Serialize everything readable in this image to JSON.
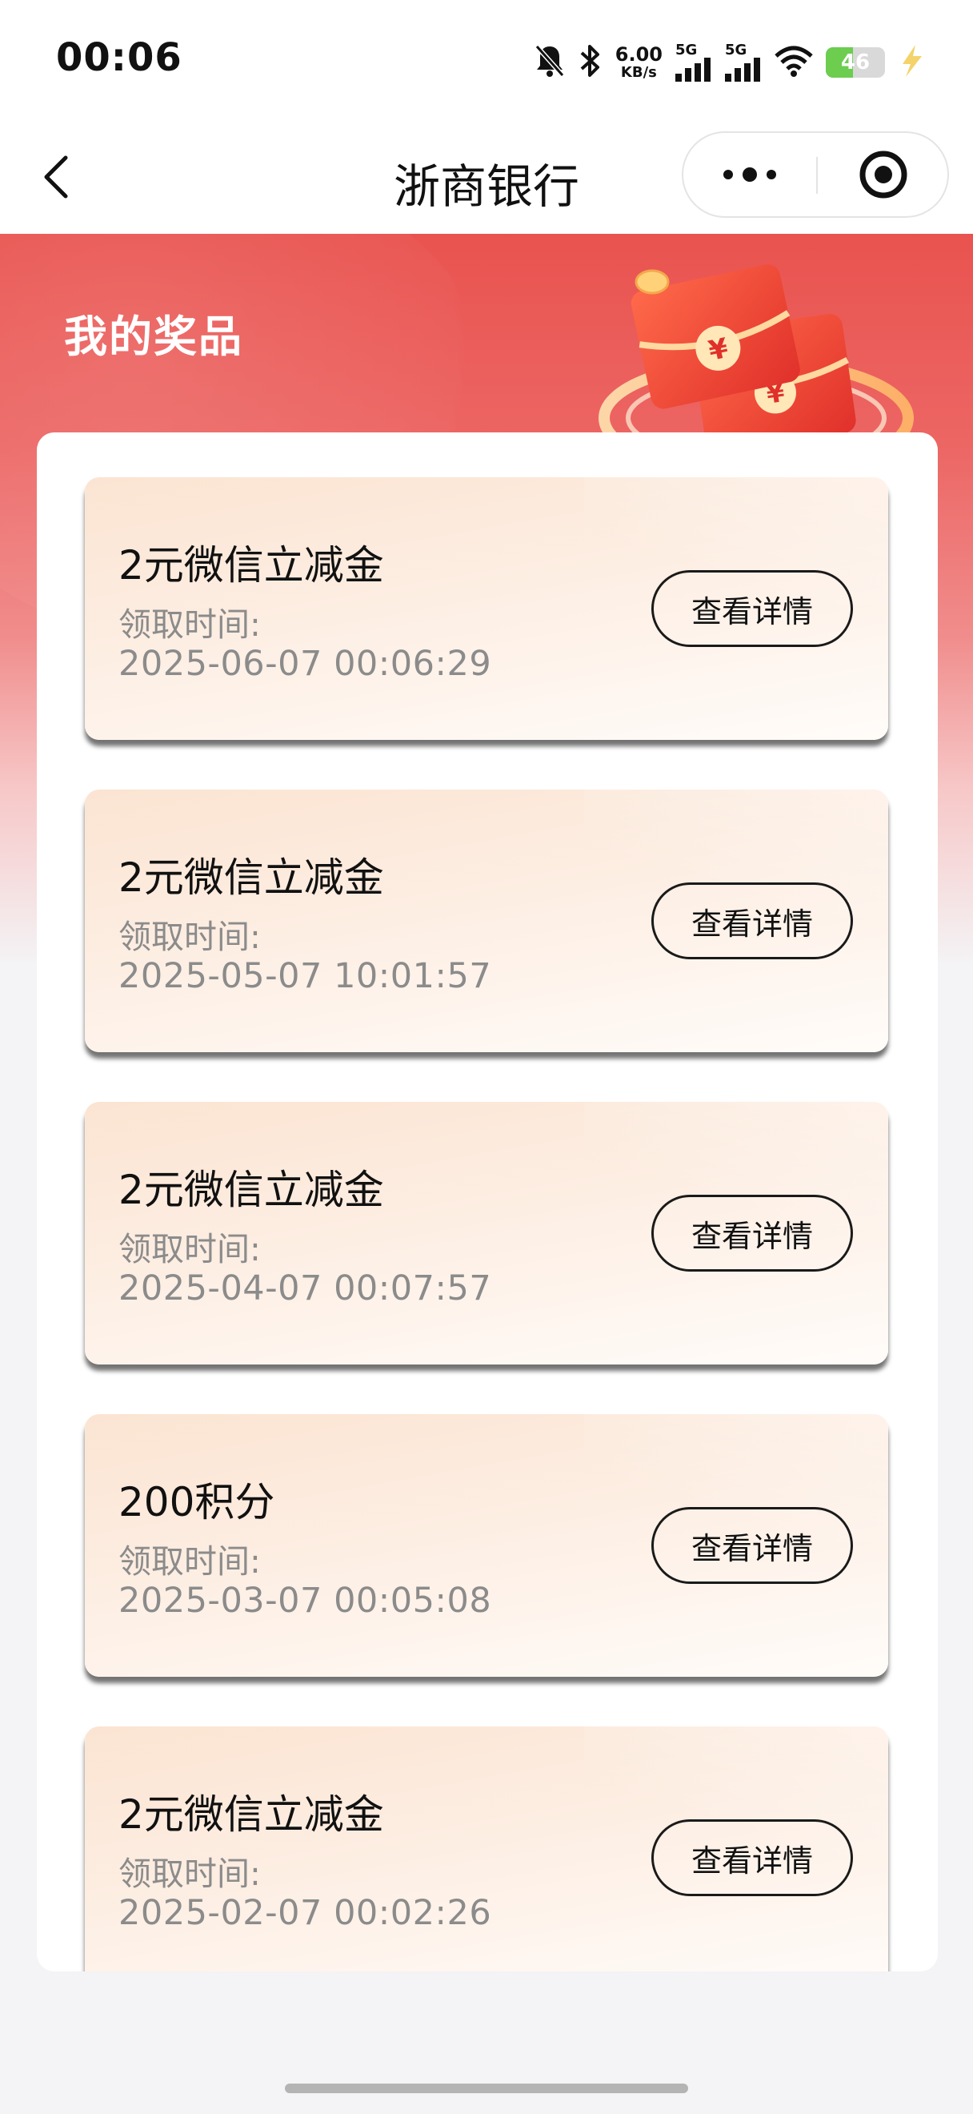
{
  "status_bar": {
    "time": "00:06",
    "net_speed_value": "6.00",
    "net_speed_unit": "KB/s",
    "signal1_label": "5G",
    "signal2_label": "5G",
    "battery_level": "46",
    "battery_fraction": 0.46
  },
  "nav": {
    "title": "浙商银行"
  },
  "hero": {
    "title": "我的奖品"
  },
  "prizes": [
    {
      "name": "2元微信立减金",
      "label": "领取时间:",
      "time": "2025-06-07 00:06:29",
      "button": "查看详情"
    },
    {
      "name": "2元微信立减金",
      "label": "领取时间:",
      "time": "2025-05-07 10:01:57",
      "button": "查看详情"
    },
    {
      "name": "2元微信立减金",
      "label": "领取时间:",
      "time": "2025-04-07 00:07:57",
      "button": "查看详情"
    },
    {
      "name": "200积分",
      "label": "领取时间:",
      "time": "2025-03-07 00:05:08",
      "button": "查看详情"
    },
    {
      "name": "2元微信立减金",
      "label": "领取时间:",
      "time": "2025-02-07 00:02:26",
      "button": "查看详情"
    }
  ],
  "colors": {
    "brand_red": "#e9534f",
    "card_peach": "#fbe4d2",
    "muted_text": "#8b8b8b"
  }
}
